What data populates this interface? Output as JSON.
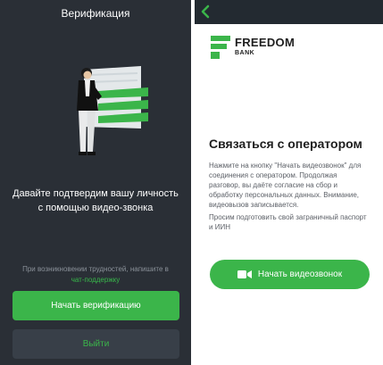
{
  "left_screen": {
    "title": "Верификация",
    "headline_line1": "Давайте подтвердим вашу личность",
    "headline_line2": "с помощью видео-звонка",
    "help_text": "При возникновении трудностей, напишите в",
    "help_link": "чат-поддержку",
    "verify_button": "Начать верификацию",
    "exit_button": "Выйти"
  },
  "right_screen": {
    "back_icon": "chevron-left-icon",
    "brand_name": "FREEDOM",
    "brand_sub": "BANK",
    "title": "Связаться с оператором",
    "body": "Нажмите на кнопку \"Начать видеозвонок\" для соединения с оператором. Продолжая разговор, вы даёте согласие на сбор и обработку персональных данных. Внимание, видеовызов записывается.",
    "note": "Просим подготовить свой заграничный паспорт и ИИН",
    "call_button": "Начать видеозвонок",
    "call_icon": "video-camera-icon"
  },
  "colors": {
    "accent": "#3bb54a",
    "dark_bg": "#2a2f36",
    "topbar": "#232a31"
  }
}
